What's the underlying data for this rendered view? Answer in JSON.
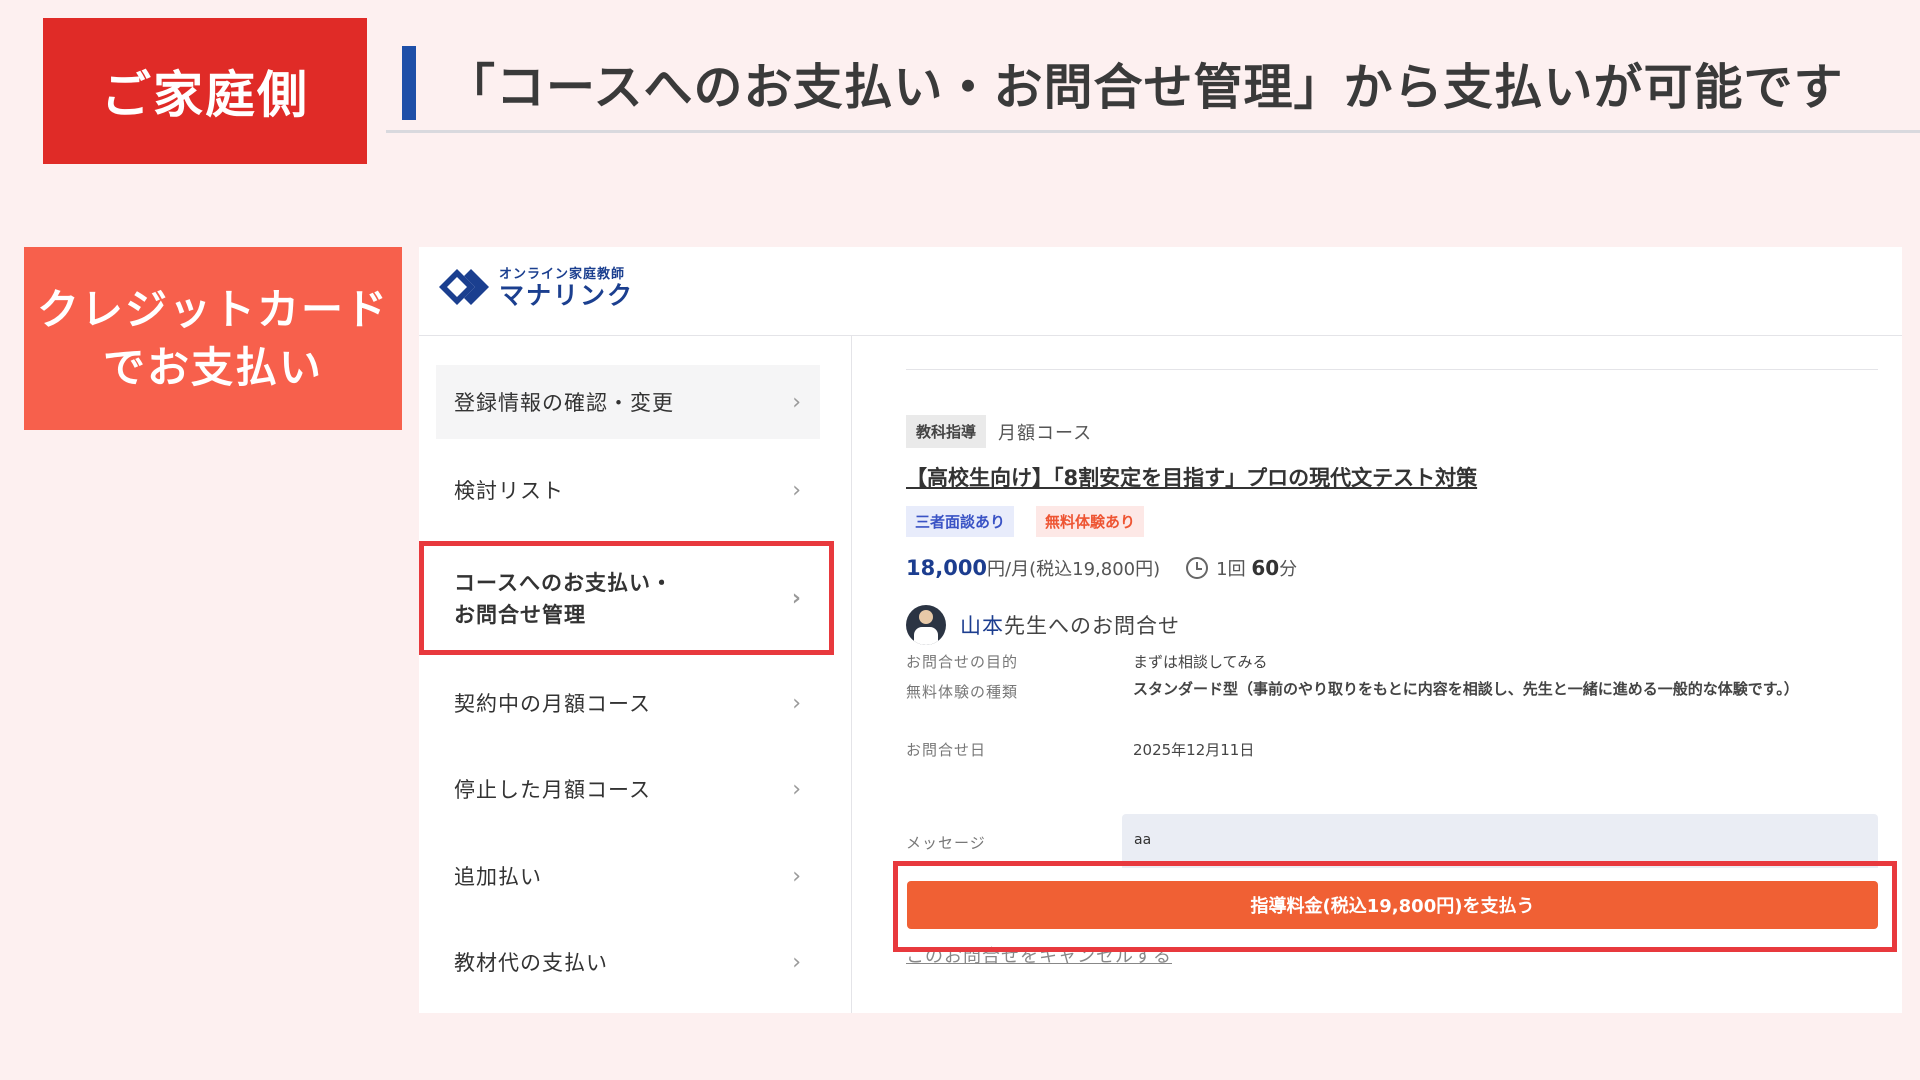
{
  "slide": {
    "family_label": "ご家庭側",
    "headline": "「コースへのお支払い・お問合せ管理」から支払いが可能です",
    "card_label_line1": "クレジットカード",
    "card_label_line2": "でお支払い"
  },
  "logo": {
    "small": "オンライン家庭教師",
    "big": "マナリンク"
  },
  "sidebar": {
    "items": [
      {
        "label": "登録情報の確認・変更"
      },
      {
        "label": "検討リスト"
      },
      {
        "label_line1": "コースへのお支払い・",
        "label_line2": "お問合せ管理"
      },
      {
        "label": "契約中の月額コース"
      },
      {
        "label": "停止した月額コース"
      },
      {
        "label": "追加払い"
      },
      {
        "label": "教材代の支払い"
      }
    ],
    "chevron": "›"
  },
  "course": {
    "category": "教科指導",
    "type": "月額コース",
    "title": "【高校生向け】「8割安定を目指す」プロの現代文テスト対策",
    "badges": [
      "三者面談あり",
      "無料体験あり"
    ],
    "price_amount": "18,000",
    "price_unit": "円/月(税込19,800円)",
    "duration_prefix": "1回 ",
    "duration_value": "60",
    "duration_suffix": "分"
  },
  "inquiry": {
    "teacher_name": "山本",
    "teacher_suffix": "先生へのお問合せ",
    "rows": [
      {
        "label": "お問合せの目的",
        "value": "まずは相談してみる"
      },
      {
        "label": "無料体験の種類",
        "value": "スタンダード型（事前のやり取りをもとに内容を相談し、先生と一緒に進める一般的な体験です。）"
      },
      {
        "label": "お問合せ日",
        "value": "2025年12月11日"
      },
      {
        "label": "メッセージ",
        "value": "aa"
      }
    ],
    "pay_button": "指導料金(税込19,800円)を支払う",
    "cancel_link": "このお問合せをキャンセルする"
  },
  "colors": {
    "family_tag": "#e02b27",
    "card_tag": "#f7604c",
    "accent_blue": "#1e4fa8",
    "highlight": "#e8393d",
    "pay_button": "#f06034"
  }
}
